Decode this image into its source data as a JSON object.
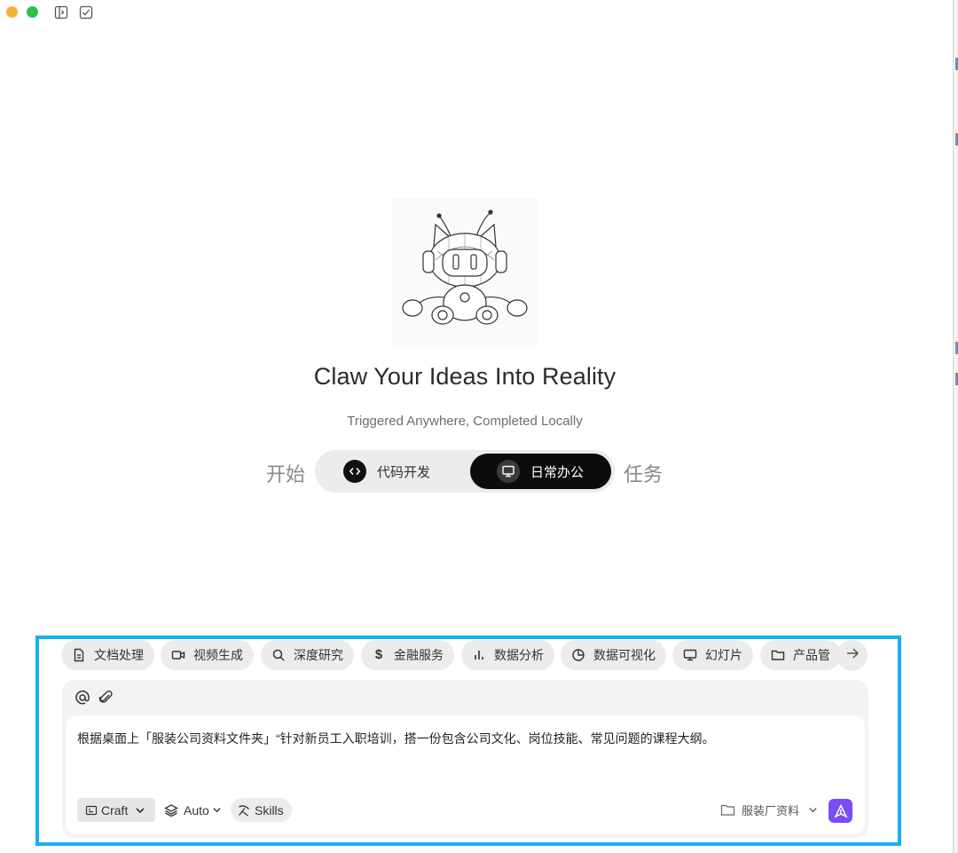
{
  "colors": {
    "traffic_yellow": "#f4b43c",
    "traffic_green": "#31c048",
    "accent_send": "#7b4cf5",
    "highlight_frame": "#19aef0",
    "active_toggle": "#0c0c0c"
  },
  "titlebar": {
    "icons": [
      "sidebar-toggle-icon",
      "task-check-icon"
    ]
  },
  "hero": {
    "title": "Claw Your Ideas Into Reality",
    "subtitle": "Triggered Anywhere, Completed Locally",
    "start_word": "开始",
    "end_word": "任务",
    "toggle": {
      "options": [
        {
          "label": "代码开发",
          "icon": "code-icon",
          "active": false
        },
        {
          "label": "日常办公",
          "icon": "presentation-icon",
          "active": true
        }
      ]
    }
  },
  "chips": [
    {
      "label": "文档处理",
      "icon": "document-icon"
    },
    {
      "label": "视频生成",
      "icon": "video-icon"
    },
    {
      "label": "深度研究",
      "icon": "search-icon"
    },
    {
      "label": "金融服务",
      "icon": "dollar-icon"
    },
    {
      "label": "数据分析",
      "icon": "bar-chart-icon"
    },
    {
      "label": "数据可视化",
      "icon": "pie-chart-icon"
    },
    {
      "label": "幻灯片",
      "icon": "monitor-icon"
    },
    {
      "label": "产品管",
      "icon": "folder-icon"
    }
  ],
  "composer": {
    "prompt_text": "根据桌面上「服装公司资料文件夹」“针对新员工入职培训，搭一份包含公司文化、岗位技能、常见问题的课程大纲。",
    "mode_label": "Craft",
    "model_label": "Auto",
    "skills_label": "Skills",
    "folder_label": "服装厂资料"
  }
}
